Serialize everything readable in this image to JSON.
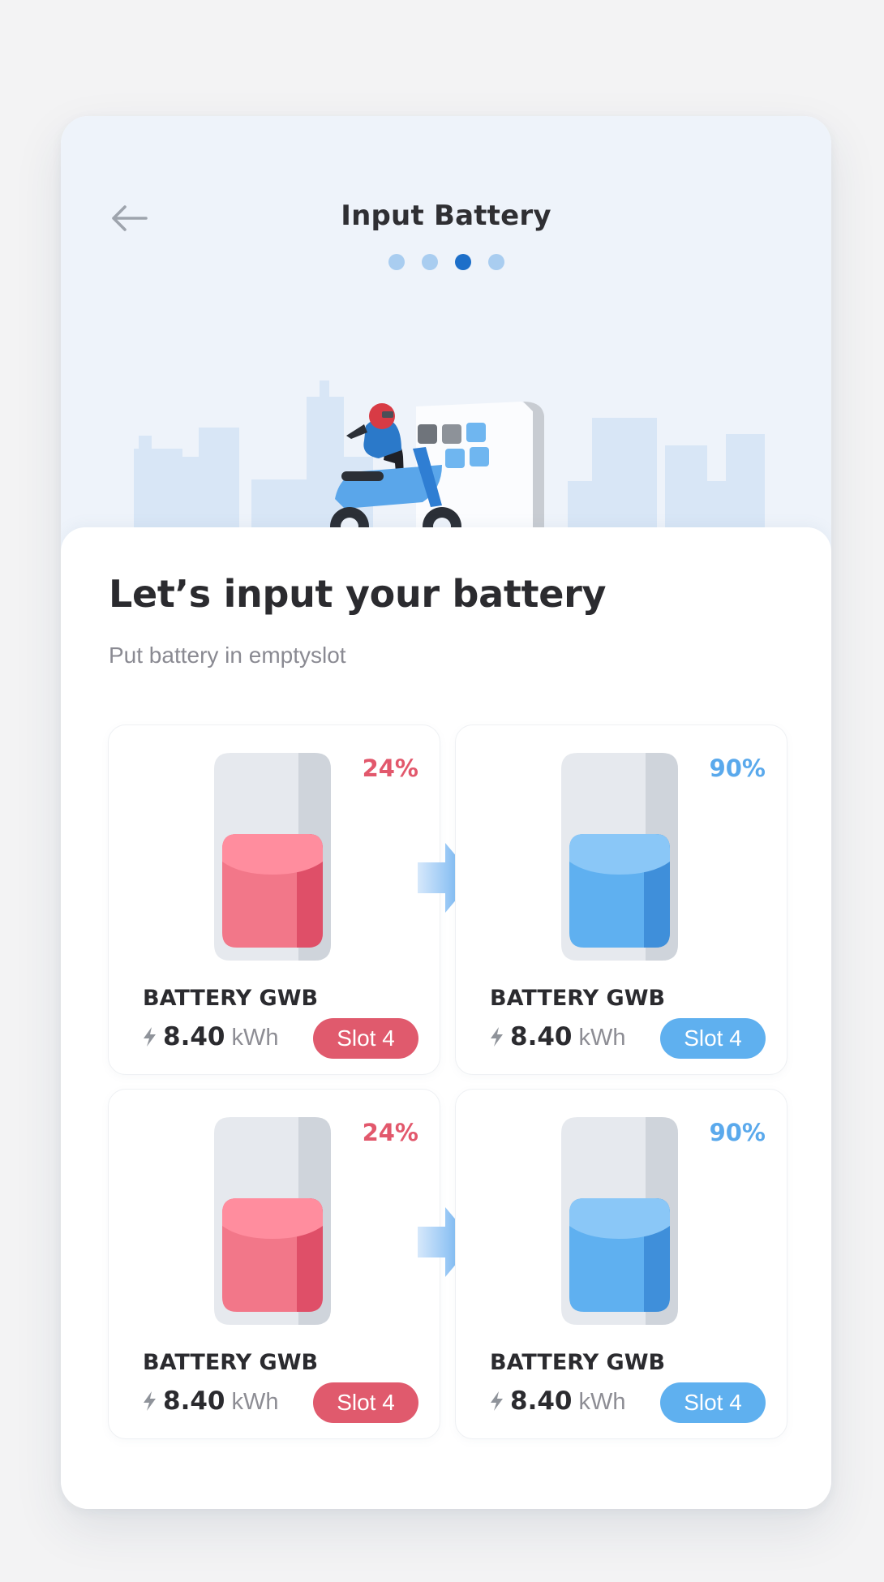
{
  "header": {
    "title": "Input Battery",
    "steps": 4,
    "active_step": 3
  },
  "content": {
    "heading": "Let’s input your battery",
    "subheading": "Put battery in emptyslot"
  },
  "swaps": [
    {
      "from": {
        "percent": "24%",
        "level": 0.24,
        "name": "BATTERY GWB",
        "energy_value": "8.40",
        "energy_unit": "kWh",
        "slot": "Slot 4"
      },
      "to": {
        "percent": "90%",
        "level": 0.9,
        "name": "BATTERY GWB",
        "energy_value": "8.40",
        "energy_unit": "kWh",
        "slot": "Slot 4"
      }
    },
    {
      "from": {
        "percent": "24%",
        "level": 0.24,
        "name": "BATTERY GWB",
        "energy_value": "8.40",
        "energy_unit": "kWh",
        "slot": "Slot 4"
      },
      "to": {
        "percent": "90%",
        "level": 0.9,
        "name": "BATTERY GWB",
        "energy_value": "8.40",
        "energy_unit": "kWh",
        "slot": "Slot 4"
      }
    }
  ],
  "icons": {
    "back": "arrow-left-icon",
    "bolt": "lightning-bolt-icon",
    "direction": "arrow-right-icon"
  },
  "colors": {
    "low_charge": "#e05a6d",
    "high_charge": "#5fb0ef",
    "active_step": "#1d6fc9",
    "inactive_step": "#a9cdf0"
  }
}
